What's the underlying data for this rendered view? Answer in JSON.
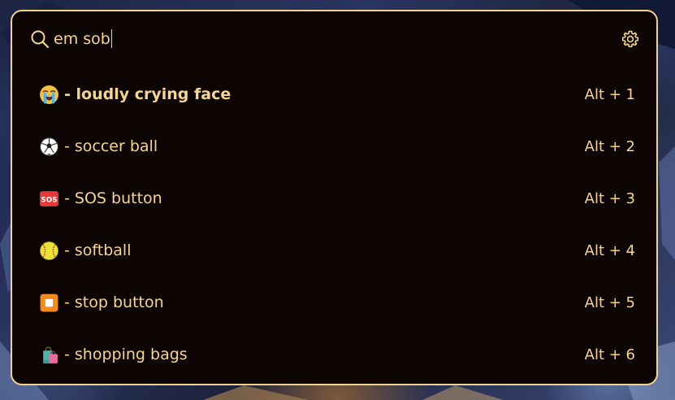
{
  "search": {
    "query": "em sob"
  },
  "icons": {
    "search": "search-icon",
    "settings": "gear-icon"
  },
  "colors": {
    "accent": "#f6d68c",
    "border": "#f3d38a",
    "panel_background": "#0c0503"
  },
  "results": [
    {
      "emoji_icon": "loudly-crying-face-icon",
      "label": " - loudly crying face",
      "shortcut": "Alt + 1",
      "selected": true
    },
    {
      "emoji_icon": "soccer-ball-icon",
      "label": " - soccer ball",
      "shortcut": "Alt + 2",
      "selected": false
    },
    {
      "emoji_icon": "sos-button-icon",
      "label": " - SOS button",
      "shortcut": "Alt + 3",
      "selected": false
    },
    {
      "emoji_icon": "softball-icon",
      "label": " - softball",
      "shortcut": "Alt + 4",
      "selected": false
    },
    {
      "emoji_icon": "stop-button-icon",
      "label": " - stop button",
      "shortcut": "Alt + 5",
      "selected": false
    },
    {
      "emoji_icon": "shopping-bags-icon",
      "label": " - shopping bags",
      "shortcut": "Alt + 6",
      "selected": false
    }
  ]
}
